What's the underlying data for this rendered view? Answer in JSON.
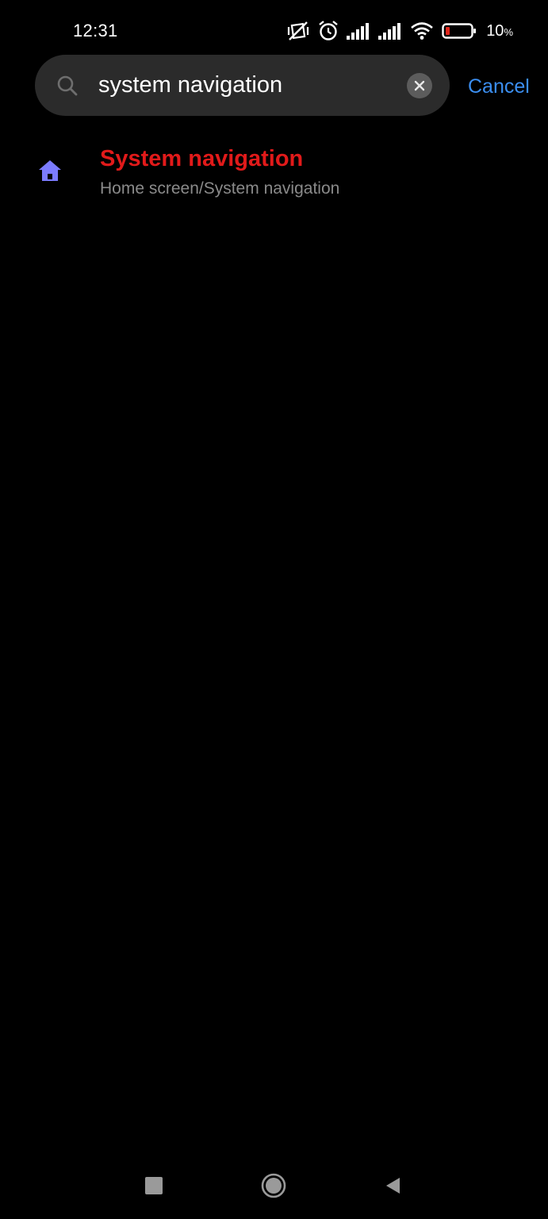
{
  "status_bar": {
    "time": "12:31",
    "battery_percent": "10",
    "battery_percent_sign": "%",
    "icons": [
      "mute-vibrate-icon",
      "alarm-icon",
      "signal-icon",
      "signal-icon",
      "wifi-icon",
      "battery-low-icon"
    ],
    "battery_color": "#e0261c"
  },
  "search": {
    "value": "system navigation",
    "placeholder": "",
    "cancel_label": "Cancel",
    "accent_color": "#3b8ef0"
  },
  "results": [
    {
      "title": "System navigation",
      "path": "Home screen/System navigation",
      "icon": "home-icon",
      "title_color": "#e11a1a",
      "icon_color": "#7b7bff"
    }
  ],
  "nav_bar": {
    "buttons": [
      "recents-icon",
      "home-circle-icon",
      "back-icon"
    ]
  }
}
